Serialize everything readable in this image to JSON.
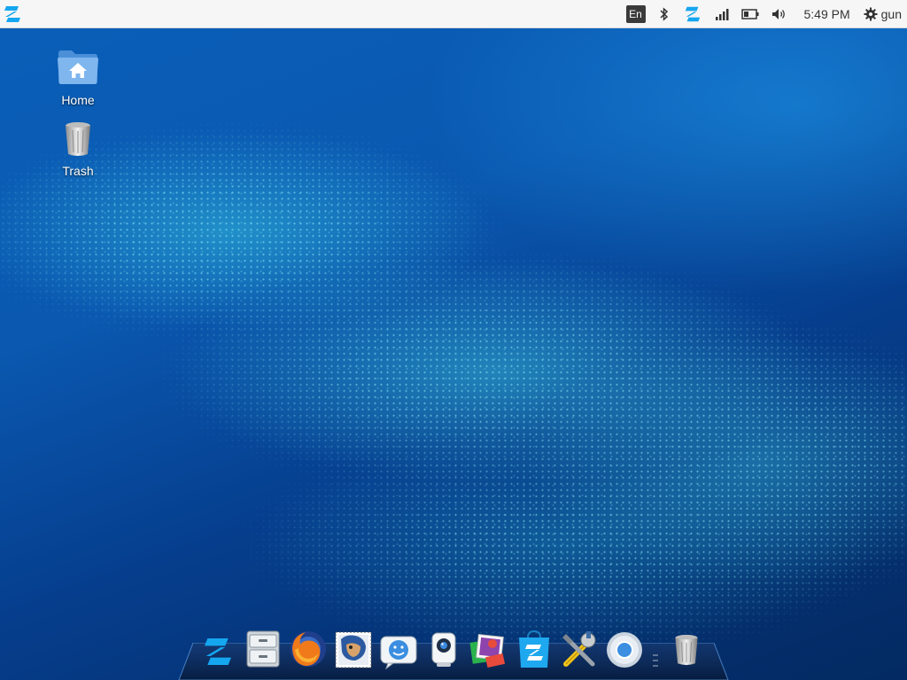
{
  "top_panel": {
    "menu_icon": "zorin-logo-icon",
    "tray": {
      "language": "En",
      "bluetooth_icon": "bluetooth-icon",
      "zorin_icon": "zorin-logo-icon",
      "network_icon": "signal-icon",
      "battery_icon": "battery-icon",
      "volume_icon": "volume-icon",
      "clock": "5:49 PM",
      "user_icon": "gear-icon",
      "user_name": "gun"
    }
  },
  "desktop": {
    "icons": [
      {
        "label": "Home",
        "icon": "home-folder-icon"
      },
      {
        "label": "Trash",
        "icon": "trash-icon"
      }
    ]
  },
  "dock": {
    "items": [
      {
        "icon": "zorin-menu-icon"
      },
      {
        "icon": "file-manager-icon"
      },
      {
        "icon": "firefox-icon"
      },
      {
        "icon": "thunderbird-icon"
      },
      {
        "icon": "empathy-chat-icon"
      },
      {
        "icon": "webcam-icon"
      },
      {
        "icon": "image-viewer-icon"
      },
      {
        "icon": "software-store-icon"
      },
      {
        "icon": "settings-tools-icon"
      },
      {
        "icon": "chromium-icon"
      },
      {
        "icon": "dock-separator"
      },
      {
        "icon": "trash-icon"
      }
    ]
  },
  "colors": {
    "panel_bg": "#f6f6f6",
    "zorin_blue": "#15a6f0",
    "wallpaper_dark": "#04306f",
    "wallpaper_light": "#0a5fb8"
  }
}
